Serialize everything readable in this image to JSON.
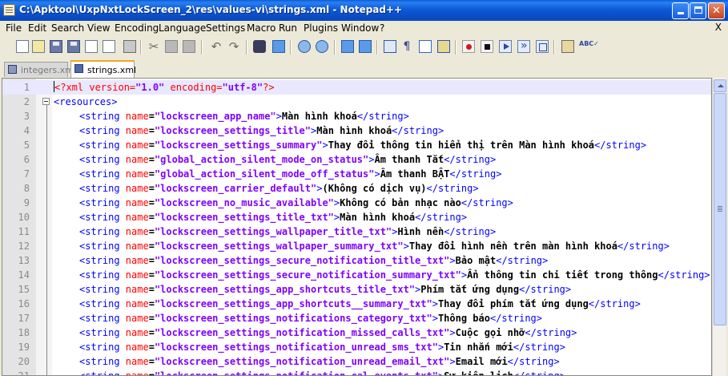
{
  "window": {
    "title": "C:\\Apktool\\UxpNxtLockScreen_2\\res\\values-vi\\strings.xml - Notepad++"
  },
  "menu": [
    "File",
    "Edit",
    "Search",
    "View",
    "Encoding",
    "Language",
    "Settings",
    "Macro",
    "Run",
    "Plugins",
    "Window",
    "?"
  ],
  "menu_close": "X",
  "tabs": [
    {
      "label": "integers.xml",
      "active": false
    },
    {
      "label": "strings.xml",
      "active": true
    }
  ],
  "editor": {
    "current_line": 1,
    "lines": [
      {
        "n": "1",
        "pi": "<?xml version=\"1.0\" encoding=\"utf-8\"?>"
      },
      {
        "n": "2",
        "open": "<resources>"
      },
      {
        "n": "3",
        "name": "\"lockscreen_app_name\"",
        "text": "Màn hình khoá"
      },
      {
        "n": "4",
        "name": "\"lockscreen_settings_title\"",
        "text": "Màn hình khoá"
      },
      {
        "n": "5",
        "name": "\"lockscreen_settings_summary\"",
        "text": "Thay đổi thông tin hiển thị trên Màn hình khoá"
      },
      {
        "n": "6",
        "name": "\"global_action_silent_mode_on_status\"",
        "text": "Âm thanh Tắt"
      },
      {
        "n": "7",
        "name": "\"global_action_silent_mode_off_status\"",
        "text": "Âm thanh BẬT"
      },
      {
        "n": "8",
        "name": "\"lockscreen_carrier_default\"",
        "text": "(Không có dịch vụ)"
      },
      {
        "n": "9",
        "name": "\"lockscreen_no_music_available\"",
        "text": "Không có bản nhạc nào"
      },
      {
        "n": "10",
        "name": "\"lockscreen_settings_title_txt\"",
        "text": "Màn hình khoá"
      },
      {
        "n": "11",
        "name": "\"lockscreen_settings_wallpaper_title_txt\"",
        "text": "Hình nền"
      },
      {
        "n": "12",
        "name": "\"lockscreen_settings_wallpaper_summary_txt\"",
        "text": "Thay đổi hình nền trên màn hình khoá"
      },
      {
        "n": "13",
        "name": "\"lockscreen_settings_secure_notification_title_txt\"",
        "text": "Bảo mật"
      },
      {
        "n": "14",
        "name": "\"lockscreen_settings_secure_notification_summary_txt\"",
        "text": "Ẩn thông tin chi tiết trong thông"
      },
      {
        "n": "15",
        "name": "\"lockscreen_settings_app_shortcuts_title_txt\"",
        "text": "Phím tắt ứng dụng"
      },
      {
        "n": "16",
        "name": "\"lockscreen_settings_app_shortcuts__summary_txt\"",
        "text": "Thay đổi phím tắt ứng dụng"
      },
      {
        "n": "17",
        "name": "\"lockscreen_settings_notifications_category_txt\"",
        "text": "Thông báo"
      },
      {
        "n": "18",
        "name": "\"lockscreen_settings_notification_missed_calls_txt\"",
        "text": "Cuộc gọi nhỡ"
      },
      {
        "n": "19",
        "name": "\"lockscreen_settings_notification_unread_sms_txt\"",
        "text": "Tin nhắn mới"
      },
      {
        "n": "20",
        "name": "\"lockscreen_settings_notification_unread_email_txt\"",
        "text": "Email mới"
      },
      {
        "n": "21",
        "name": "\"lockscreen_settings_notification_cal_events_txt\"",
        "text": "Sự kiện lịch"
      }
    ],
    "tag_open": "<string",
    "attr": "name",
    "tag_close": "</string>"
  },
  "colors": {
    "tag": "#0000ff",
    "attribute": "#ff0000",
    "value": "#8000ff",
    "text": "#000000",
    "titlebar": "#0a5fd8"
  }
}
